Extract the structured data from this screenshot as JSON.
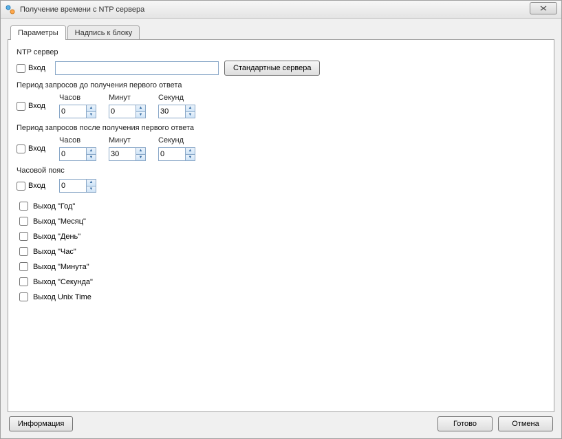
{
  "window": {
    "title": "Получение времени с NTP сервера"
  },
  "tabs": {
    "parameters": "Параметры",
    "block_label": "Надпись к блоку"
  },
  "ntp": {
    "section": "NTP сервер",
    "input_label": "Вход",
    "value": "",
    "std_button": "Стандартные сервера"
  },
  "period_before": {
    "section": "Период запросов до получения первого ответа",
    "input_label": "Вход",
    "hours_label": "Часов",
    "minutes_label": "Минут",
    "seconds_label": "Секунд",
    "hours": "0",
    "minutes": "0",
    "seconds": "30"
  },
  "period_after": {
    "section": "Период запросов после получения первого ответа",
    "input_label": "Вход",
    "hours_label": "Часов",
    "minutes_label": "Минут",
    "seconds_label": "Секунд",
    "hours": "0",
    "minutes": "30",
    "seconds": "0"
  },
  "timezone": {
    "section": "Часовой пояс",
    "input_label": "Вход",
    "value": "0"
  },
  "outputs": [
    "Выход \"Год\"",
    "Выход \"Месяц\"",
    "Выход \"День\"",
    "Выход \"Час\"",
    "Выход \"Минута\"",
    "Выход \"Секунда\"",
    "Выход Unix Time"
  ],
  "footer": {
    "info": "Информация",
    "ok": "Готово",
    "cancel": "Отмена"
  }
}
